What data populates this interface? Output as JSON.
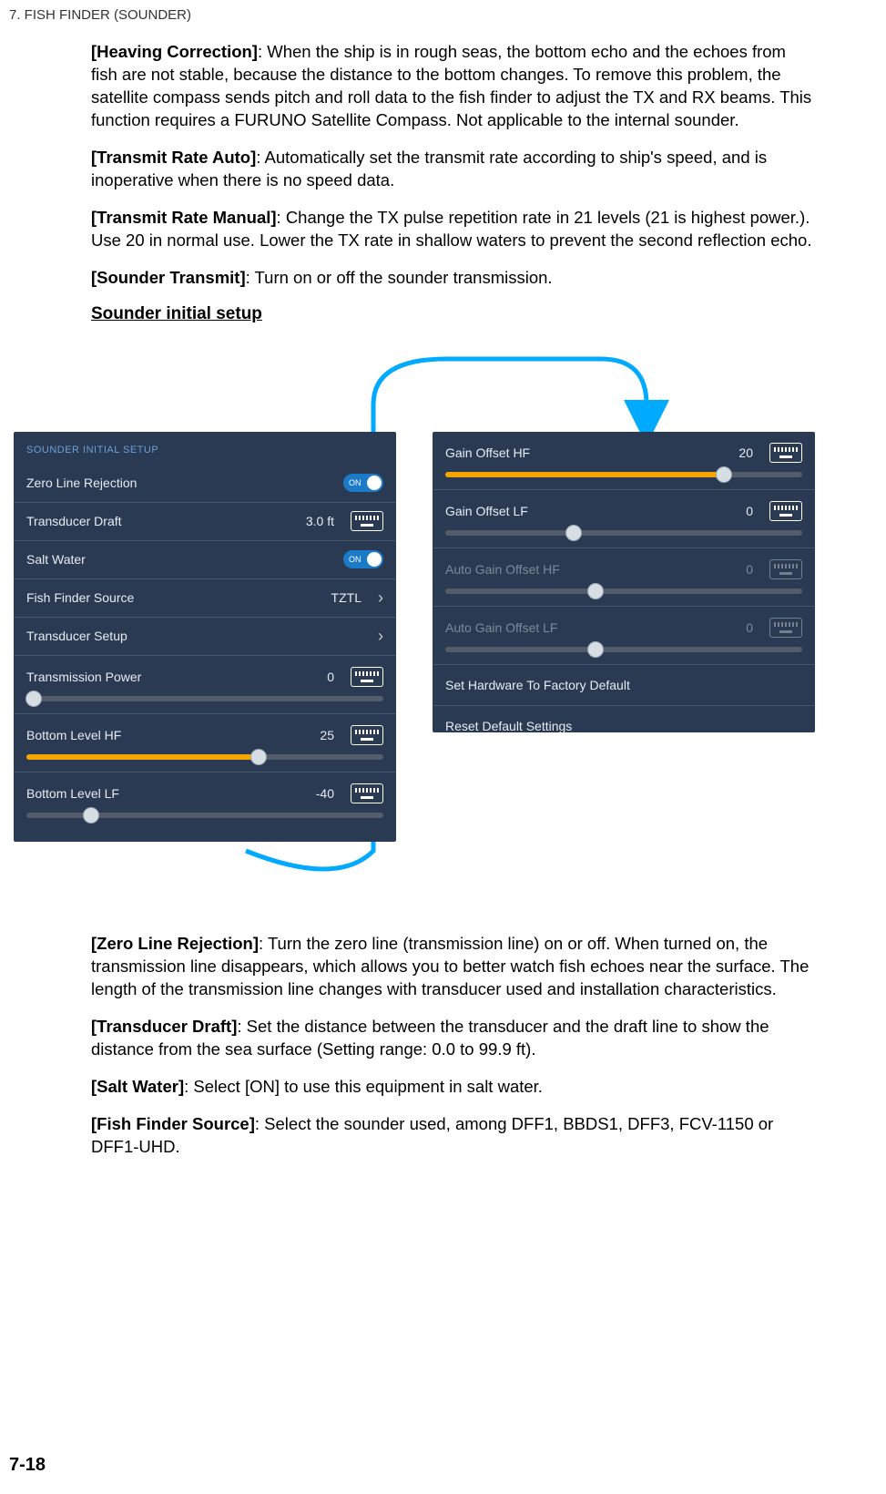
{
  "chapter": "7.  FISH FINDER (SOUNDER)",
  "paragraphs": {
    "heaving": "[Heaving Correction]: When the ship is in rough seas, the bottom echo and the echoes from fish are not stable, because the distance to the bottom changes. To remove this problem, the satellite compass sends pitch and roll data to the fish finder to adjust the TX and RX beams. This function requires a FURUNO Satellite Compass. Not applicable to the internal sounder.",
    "txrate_auto": "[Transmit Rate Auto]: Automatically set the transmit rate according to ship's speed, and is inoperative when there is no speed data.",
    "txrate_manual": "[Transmit Rate Manual]: Change the TX pulse repetition rate in 21 levels (21 is highest power.). Use 20 in normal use. Lower the TX rate in shallow waters to prevent the second reflection echo.",
    "sounder_transmit": "[Sounder Transmit]: Turn on or off the sounder transmission.",
    "zero_line": "[Zero Line Rejection]: Turn the zero line (transmission line) on or off. When turned on, the transmission line disappears, which allows you to better watch fish echoes near the surface. The length of the transmission line changes with transducer used and installation characteristics.",
    "transducer_draft": "[Transducer Draft]: Set the distance between the transducer and the draft line to show the distance from the sea surface (Setting range: 0.0 to 99.9 ft).",
    "salt_water": "[Salt Water]: Select [ON] to use this equipment in salt water.",
    "fish_finder_source": "[Fish Finder Source]: Select the sounder used, among DFF1, BBDS1, DFF3, FCV-1150 or DFF1-UHD."
  },
  "subhead": "Sounder initial setup",
  "panel_left": {
    "header": "SOUNDER INITIAL SETUP",
    "rows": {
      "zero_line": {
        "label": "Zero Line Rejection",
        "toggle": "ON"
      },
      "transducer_draft": {
        "label": "Transducer Draft",
        "value": "3.0 ft"
      },
      "salt_water": {
        "label": "Salt Water",
        "toggle": "ON"
      },
      "fish_source": {
        "label": "Fish Finder Source",
        "value": "TZTL"
      },
      "transducer_setup": {
        "label": "Transducer Setup"
      },
      "tx_power": {
        "label": "Transmission Power",
        "value": "0",
        "fill_pct": 2,
        "thumb_pct": 2
      },
      "bottom_hf": {
        "label": "Bottom Level HF",
        "value": "25",
        "fill_pct": 65,
        "thumb_pct": 65
      },
      "bottom_lf": {
        "label": "Bottom Level LF",
        "value": "-40",
        "fill_pct": 0,
        "thumb_pct": 18
      }
    }
  },
  "panel_right": {
    "rows": {
      "gain_hf": {
        "label": "Gain Offset HF",
        "value": "20",
        "fill_pct": 78,
        "thumb_pct": 78
      },
      "gain_lf": {
        "label": "Gain Offset LF",
        "value": "0",
        "fill_pct": 0,
        "thumb_pct": 36
      },
      "auto_hf": {
        "label": "Auto Gain Offset HF",
        "value": "0",
        "fill_pct": 0,
        "thumb_pct": 42,
        "disabled": true
      },
      "auto_lf": {
        "label": "Auto Gain Offset LF",
        "value": "0",
        "fill_pct": 0,
        "thumb_pct": 42,
        "disabled": true
      },
      "factory": {
        "label": "Set Hardware To Factory Default"
      },
      "reset": {
        "label": "Reset Default Settings"
      }
    }
  },
  "page_number": "7-18"
}
